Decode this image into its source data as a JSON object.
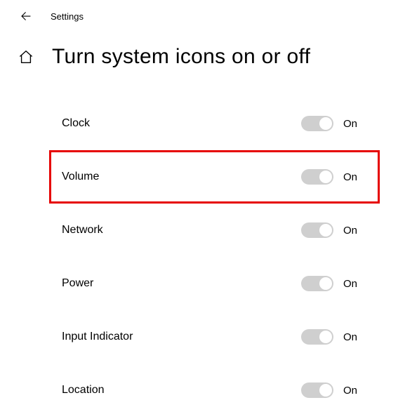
{
  "header": {
    "app_title": "Settings"
  },
  "page": {
    "title": "Turn system icons on or off"
  },
  "items": [
    {
      "label": "Clock",
      "state_label": "On",
      "on": true,
      "highlighted": false
    },
    {
      "label": "Volume",
      "state_label": "On",
      "on": true,
      "highlighted": true
    },
    {
      "label": "Network",
      "state_label": "On",
      "on": true,
      "highlighted": false
    },
    {
      "label": "Power",
      "state_label": "On",
      "on": true,
      "highlighted": false
    },
    {
      "label": "Input Indicator",
      "state_label": "On",
      "on": true,
      "highlighted": false
    },
    {
      "label": "Location",
      "state_label": "On",
      "on": true,
      "highlighted": false
    }
  ],
  "colors": {
    "highlight": "#e60000",
    "toggle_track": "#cfcfcf",
    "toggle_knob": "#ffffff"
  }
}
